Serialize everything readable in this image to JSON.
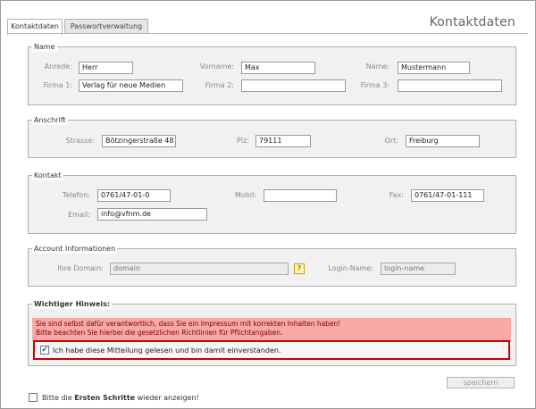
{
  "tabs": [
    {
      "label": "Kontaktdaten",
      "active": true
    },
    {
      "label": "Passwortverwaltung",
      "active": false
    }
  ],
  "page_title": "Kontaktdaten",
  "sections": {
    "name": {
      "legend": "Name",
      "anrede_label": "Anrede:",
      "anrede_value": "Herr",
      "vorname_label": "Vorname:",
      "vorname_value": "Max",
      "name_label": "Name:",
      "name_value": "Mustermann",
      "firma1_label": "Firma 1:",
      "firma1_value": "Verlag für neue Medien",
      "firma2_label": "Firma 2:",
      "firma2_value": "",
      "firma3_label": "Firma 3:",
      "firma3_value": ""
    },
    "anschrift": {
      "legend": "Anschrift",
      "strasse_label": "Strasse:",
      "strasse_value": "Bötzingerstraße 48",
      "plz_label": "Plz:",
      "plz_value": "79111",
      "ort_label": "Ort:",
      "ort_value": "Freiburg"
    },
    "kontakt": {
      "legend": "Kontakt",
      "telefon_label": "Telefon:",
      "telefon_value": "0761/47-01-0",
      "mobil_label": "Mobil:",
      "mobil_value": "",
      "fax_label": "Fax:",
      "fax_value": "0761/47-01-111",
      "email_label": "Email:",
      "email_value": "info@vfnm.de"
    },
    "account": {
      "legend": "Account Informationen",
      "domain_label": "Ihre Domain:",
      "domain_value": "domain",
      "help_label": "?",
      "login_label": "Login-Name:",
      "login_value": "login-name"
    },
    "hinweis": {
      "legend": "Wichtiger Hinweis:",
      "warning_line1": "Sie sind selbst dafür verantwortlich, dass Sie ein Impressum mit korrekten Inhalten haben!",
      "warning_line2": "Bitte beachten Sie hierbei die gesetzlichen Richtlinien für Pflichtangaben.",
      "confirm_text": "Ich habe diese Mitteilung gelesen und bin damit einverstanden.",
      "confirm_checked": true
    }
  },
  "save_label": "speichern",
  "bottom": {
    "text_before": "Bitte die ",
    "text_bold": "Ersten Schritte",
    "text_after": " wieder anzeigen!",
    "checked": false
  },
  "colors": {
    "warning_bg": "#f9a8a8",
    "confirm_border": "#cc0000",
    "fieldset_bg": "#f1f1f1"
  }
}
